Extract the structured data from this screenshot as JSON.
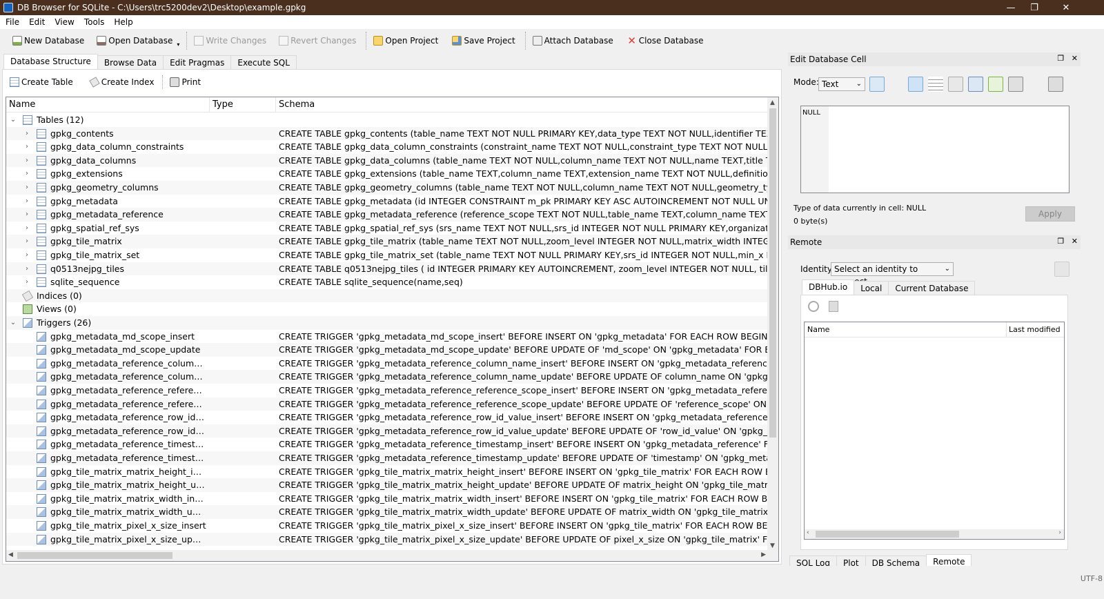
{
  "window": {
    "title": "DB Browser for SQLite - C:\\Users\\trc5200dev2\\Desktop\\example.gpkg",
    "minimize_glyph": "—",
    "maximize_glyph": "❐",
    "close_glyph": "✕"
  },
  "menu": [
    "File",
    "Edit",
    "View",
    "Tools",
    "Help"
  ],
  "toolbar": {
    "new_database": "New Database",
    "open_database": "Open Database",
    "write_changes": "Write Changes",
    "revert_changes": "Revert Changes",
    "open_project": "Open Project",
    "save_project": "Save Project",
    "attach_database": "Attach Database",
    "close_database": "Close Database"
  },
  "main_tabs": [
    "Database Structure",
    "Browse Data",
    "Edit Pragmas",
    "Execute SQL"
  ],
  "structure_toolbar": {
    "create_table": "Create Table",
    "create_index": "Create Index",
    "print": "Print"
  },
  "tree": {
    "columns": [
      "Name",
      "Type",
      "Schema"
    ],
    "rows": [
      {
        "level": 0,
        "expand": "open",
        "icon": "tables-icon",
        "name": "Tables (12)",
        "schema": ""
      },
      {
        "level": 1,
        "expand": "closed",
        "icon": "table-icon",
        "name": "gpkg_contents",
        "schema": "CREATE TABLE gpkg_contents (table_name TEXT NOT NULL PRIMARY KEY,data_type TEXT NOT NULL,identifier TEXT UNIQUE,"
      },
      {
        "level": 1,
        "expand": "closed",
        "icon": "table-icon",
        "name": "gpkg_data_column_constraints",
        "schema": "CREATE TABLE gpkg_data_column_constraints (constraint_name TEXT NOT NULL,constraint_type TEXT NOT NULL /* 'range' |"
      },
      {
        "level": 1,
        "expand": "closed",
        "icon": "table-icon",
        "name": "gpkg_data_columns",
        "schema": "CREATE TABLE gpkg_data_columns (table_name TEXT NOT NULL,column_name TEXT NOT NULL,name TEXT,title TEXT,descr"
      },
      {
        "level": 1,
        "expand": "closed",
        "icon": "table-icon",
        "name": "gpkg_extensions",
        "schema": "CREATE TABLE gpkg_extensions (table_name TEXT,column_name TEXT,extension_name TEXT NOT NULL,definition TEXT NOT"
      },
      {
        "level": 1,
        "expand": "closed",
        "icon": "table-icon",
        "name": "gpkg_geometry_columns",
        "schema": "CREATE TABLE gpkg_geometry_columns (table_name TEXT NOT NULL,column_name TEXT NOT NULL,geometry_type_name T"
      },
      {
        "level": 1,
        "expand": "closed",
        "icon": "table-icon",
        "name": "gpkg_metadata",
        "schema": "CREATE TABLE gpkg_metadata (id INTEGER CONSTRAINT m_pk PRIMARY KEY ASC AUTOINCREMENT NOT NULL UNIQUE,md_s"
      },
      {
        "level": 1,
        "expand": "closed",
        "icon": "table-icon",
        "name": "gpkg_metadata_reference",
        "schema": "CREATE TABLE gpkg_metadata_reference (reference_scope TEXT NOT NULL,table_name TEXT,column_name TEXT,row_id_v"
      },
      {
        "level": 1,
        "expand": "closed",
        "icon": "table-icon",
        "name": "gpkg_spatial_ref_sys",
        "schema": "CREATE TABLE gpkg_spatial_ref_sys (srs_name TEXT NOT NULL,srs_id INTEGER NOT NULL PRIMARY KEY,organization TEXT N"
      },
      {
        "level": 1,
        "expand": "closed",
        "icon": "table-icon",
        "name": "gpkg_tile_matrix",
        "schema": "CREATE TABLE gpkg_tile_matrix (table_name TEXT NOT NULL,zoom_level INTEGER NOT NULL,matrix_width INTEGER NOT NUL"
      },
      {
        "level": 1,
        "expand": "closed",
        "icon": "table-icon",
        "name": "gpkg_tile_matrix_set",
        "schema": "CREATE TABLE gpkg_tile_matrix_set (table_name TEXT NOT NULL PRIMARY KEY,srs_id INTEGER NOT NULL,min_x DOUBLE NO"
      },
      {
        "level": 1,
        "expand": "closed",
        "icon": "table-icon",
        "name": "q0513nejpg_tiles",
        "schema": "CREATE TABLE q0513nejpg_tiles ( id INTEGER PRIMARY KEY AUTOINCREMENT, zoom_level INTEGER NOT NULL, tile_column IN"
      },
      {
        "level": 1,
        "expand": "closed",
        "icon": "table-icon",
        "name": "sqlite_sequence",
        "schema": "CREATE TABLE sqlite_sequence(name,seq)"
      },
      {
        "level": 0,
        "expand": "none",
        "icon": "indices-icon",
        "name": "Indices (0)",
        "schema": ""
      },
      {
        "level": 0,
        "expand": "none",
        "icon": "views-icon",
        "name": "Views (0)",
        "schema": ""
      },
      {
        "level": 0,
        "expand": "open",
        "icon": "triggers-icon",
        "name": "Triggers (26)",
        "schema": ""
      },
      {
        "level": 1,
        "expand": "none",
        "icon": "trigger-icon",
        "name": "gpkg_metadata_md_scope_insert",
        "schema": "CREATE TRIGGER 'gpkg_metadata_md_scope_insert' BEFORE INSERT ON 'gpkg_metadata' FOR EACH ROW BEGIN SELECT RAI"
      },
      {
        "level": 1,
        "expand": "none",
        "icon": "trigger-icon",
        "name": "gpkg_metadata_md_scope_update",
        "schema": "CREATE TRIGGER 'gpkg_metadata_md_scope_update' BEFORE UPDATE OF 'md_scope' ON 'gpkg_metadata' FOR EACH ROW B"
      },
      {
        "level": 1,
        "expand": "none",
        "icon": "trigger-icon",
        "name": "gpkg_metadata_reference_column_na...",
        "schema": "CREATE TRIGGER 'gpkg_metadata_reference_column_name_insert' BEFORE INSERT ON 'gpkg_metadata_reference' FOR EACH"
      },
      {
        "level": 1,
        "expand": "none",
        "icon": "trigger-icon",
        "name": "gpkg_metadata_reference_column_na...",
        "schema": "CREATE TRIGGER 'gpkg_metadata_reference_column_name_update' BEFORE UPDATE OF column_name ON 'gpkg_metadata_r"
      },
      {
        "level": 1,
        "expand": "none",
        "icon": "trigger-icon",
        "name": "gpkg_metadata_reference_reference_...",
        "schema": "CREATE TRIGGER 'gpkg_metadata_reference_reference_scope_insert' BEFORE INSERT ON 'gpkg_metadata_reference' FOR EA"
      },
      {
        "level": 1,
        "expand": "none",
        "icon": "trigger-icon",
        "name": "gpkg_metadata_reference_reference_...",
        "schema": "CREATE TRIGGER 'gpkg_metadata_reference_reference_scope_update' BEFORE UPDATE OF 'reference_scope' ON 'gpkg_meta"
      },
      {
        "level": 1,
        "expand": "none",
        "icon": "trigger-icon",
        "name": "gpkg_metadata_reference_row_id_val...",
        "schema": "CREATE TRIGGER 'gpkg_metadata_reference_row_id_value_insert' BEFORE INSERT ON 'gpkg_metadata_reference' FOR EACH"
      },
      {
        "level": 1,
        "expand": "none",
        "icon": "trigger-icon",
        "name": "gpkg_metadata_reference_row_id_val...",
        "schema": "CREATE TRIGGER 'gpkg_metadata_reference_row_id_value_update' BEFORE UPDATE OF 'row_id_value' ON 'gpkg_metadata_r"
      },
      {
        "level": 1,
        "expand": "none",
        "icon": "trigger-icon",
        "name": "gpkg_metadata_reference_timestamp...",
        "schema": "CREATE TRIGGER 'gpkg_metadata_reference_timestamp_insert' BEFORE INSERT ON 'gpkg_metadata_reference' FOR EACH RO"
      },
      {
        "level": 1,
        "expand": "none",
        "icon": "trigger-icon",
        "name": "gpkg_metadata_reference_timestamp...",
        "schema": "CREATE TRIGGER 'gpkg_metadata_reference_timestamp_update' BEFORE UPDATE OF 'timestamp' ON 'gpkg_metadata_refere"
      },
      {
        "level": 1,
        "expand": "none",
        "icon": "trigger-icon",
        "name": "gpkg_tile_matrix_matrix_height_insert",
        "schema": "CREATE TRIGGER 'gpkg_tile_matrix_matrix_height_insert' BEFORE INSERT ON 'gpkg_tile_matrix' FOR EACH ROW BEGIN SELEC"
      },
      {
        "level": 1,
        "expand": "none",
        "icon": "trigger-icon",
        "name": "gpkg_tile_matrix_matrix_height_update",
        "schema": "CREATE TRIGGER 'gpkg_tile_matrix_matrix_height_update' BEFORE UPDATE OF matrix_height ON 'gpkg_tile_matrix' FOR EACH"
      },
      {
        "level": 1,
        "expand": "none",
        "icon": "trigger-icon",
        "name": "gpkg_tile_matrix_matrix_width_insert",
        "schema": "CREATE TRIGGER 'gpkg_tile_matrix_matrix_width_insert' BEFORE INSERT ON 'gpkg_tile_matrix' FOR EACH ROW BEGIN SELECT"
      },
      {
        "level": 1,
        "expand": "none",
        "icon": "trigger-icon",
        "name": "gpkg_tile_matrix_matrix_width_update",
        "schema": "CREATE TRIGGER 'gpkg_tile_matrix_matrix_width_update' BEFORE UPDATE OF matrix_width ON 'gpkg_tile_matrix' FOR EACH"
      },
      {
        "level": 1,
        "expand": "none",
        "icon": "trigger-icon",
        "name": "gpkg_tile_matrix_pixel_x_size_insert",
        "schema": "CREATE TRIGGER 'gpkg_tile_matrix_pixel_x_size_insert' BEFORE INSERT ON 'gpkg_tile_matrix' FOR EACH ROW BEGIN SELECT"
      },
      {
        "level": 1,
        "expand": "none",
        "icon": "trigger-icon",
        "name": "gpkg_tile_matrix_pixel_x_size_update",
        "schema": "CREATE TRIGGER 'gpkg_tile_matrix_pixel_x_size_update' BEFORE UPDATE OF pixel_x_size ON 'gpkg_tile_matrix' FOR EACH RO"
      }
    ]
  },
  "edit_cell": {
    "title": "Edit Database Cell",
    "mode_label": "Mode:",
    "mode_value": "Text",
    "content": "NULL",
    "type_info": "Type of data currently in cell: NULL",
    "size_info": "0 byte(s)",
    "apply": "Apply"
  },
  "remote": {
    "title": "Remote",
    "identity_label": "Identity",
    "identity_value": "Select an identity to connect",
    "tabs": [
      "DBHub.io",
      "Local",
      "Current Database"
    ],
    "columns": [
      "Name",
      "Last modified"
    ]
  },
  "bottom_tabs": [
    "SQL Log",
    "Plot",
    "DB Schema",
    "Remote"
  ],
  "status": {
    "encoding": "UTF-8"
  }
}
